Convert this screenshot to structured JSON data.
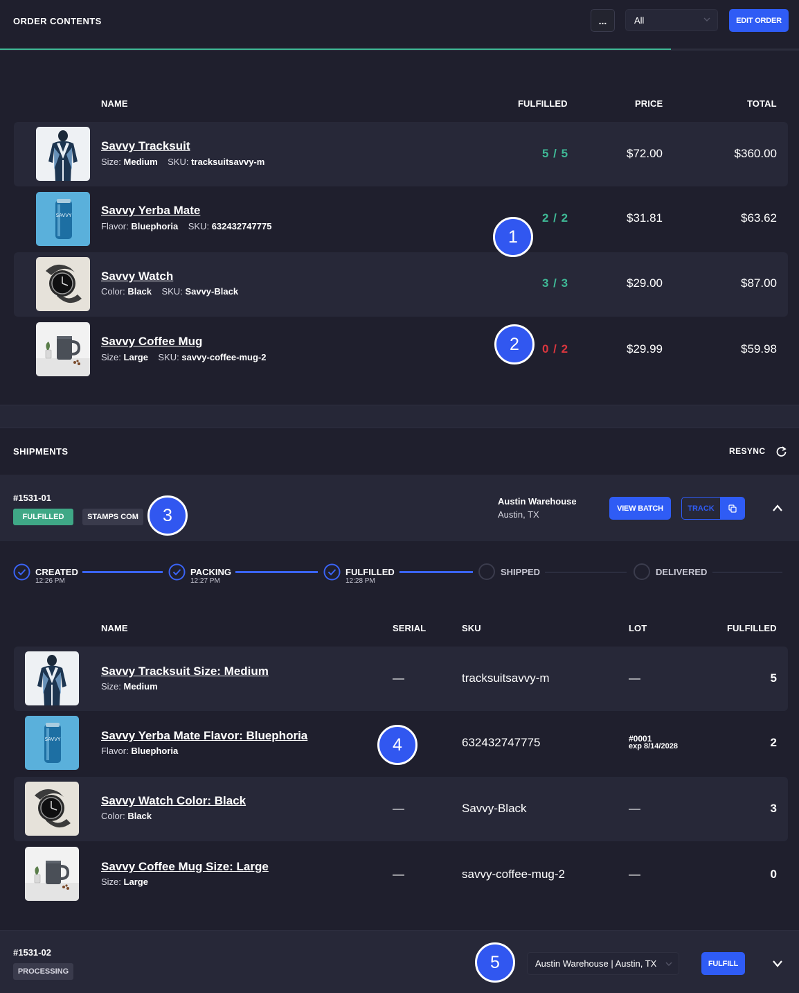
{
  "header": {
    "title": "ORDER CONTENTS",
    "more_label": "...",
    "filter_value": "All",
    "edit_label": "EDIT ORDER"
  },
  "progress": 0.84,
  "order_table": {
    "headers": {
      "name": "NAME",
      "fulfilled": "FULFILLED",
      "price": "PRICE",
      "total": "TOTAL"
    },
    "rows": [
      {
        "name": "Savvy Tracksuit",
        "attr_label": "Size:",
        "attr_value": "Medium",
        "sku_label": "SKU:",
        "sku": "tracksuitsavvy-m",
        "fulfilled": "5 / 5",
        "status": "complete",
        "price": "$72.00",
        "total": "$360.00"
      },
      {
        "name": "Savvy Yerba Mate",
        "attr_label": "Flavor:",
        "attr_value": "Bluephoria",
        "sku_label": "SKU:",
        "sku": "632432747775",
        "fulfilled": "2 / 2",
        "status": "complete",
        "price": "$31.81",
        "total": "$63.62"
      },
      {
        "name": "Savvy Watch",
        "attr_label": "Color:",
        "attr_value": "Black",
        "sku_label": "SKU:",
        "sku": "Savvy-Black",
        "fulfilled": "3 / 3",
        "status": "complete",
        "price": "$29.00",
        "total": "$87.00"
      },
      {
        "name": "Savvy Coffee Mug",
        "attr_label": "Size:",
        "attr_value": "Large",
        "sku_label": "SKU:",
        "sku": "savvy-coffee-mug-2",
        "fulfilled": "0 / 2",
        "status": "pending",
        "price": "$29.99",
        "total": "$59.98"
      }
    ]
  },
  "markers": [
    "1",
    "2",
    "3",
    "4",
    "5"
  ],
  "shipments": {
    "title": "SHIPMENTS",
    "resync_label": "RESYNC",
    "first": {
      "id": "#1531-01",
      "status": "FULFILLED",
      "carrier": "STAMPS COM",
      "warehouse": "Austin Warehouse",
      "location": "Austin, TX",
      "view_batch_label": "VIEW BATCH",
      "track_label": "TRACK",
      "steps": [
        {
          "label": "CREATED",
          "time": "12:26 PM",
          "done": true
        },
        {
          "label": "PACKING",
          "time": "12:27 PM",
          "done": true
        },
        {
          "label": "FULFILLED",
          "time": "12:28 PM",
          "done": true
        },
        {
          "label": "SHIPPED",
          "time": "",
          "done": false
        },
        {
          "label": "DELIVERED",
          "time": "",
          "done": false
        }
      ],
      "table": {
        "headers": {
          "name": "NAME",
          "serial": "SERIAL",
          "sku": "SKU",
          "lot": "LOT",
          "fulfilled": "FULFILLED"
        },
        "rows": [
          {
            "name": "Savvy Tracksuit Size: Medium",
            "attr_label": "Size:",
            "attr_value": "Medium",
            "serial": "—",
            "sku": "tracksuitsavvy-m",
            "lot": "—",
            "lot_exp": "",
            "qty": "5"
          },
          {
            "name": "Savvy Yerba Mate Flavor: Bluephoria",
            "attr_label": "Flavor:",
            "attr_value": "Bluephoria",
            "serial": "",
            "sku": "632432747775",
            "lot": "#0001",
            "lot_exp": "exp 8/14/2028",
            "qty": "2"
          },
          {
            "name": "Savvy Watch Color: Black",
            "attr_label": "Color:",
            "attr_value": "Black",
            "serial": "—",
            "sku": "Savvy-Black",
            "lot": "—",
            "lot_exp": "",
            "qty": "3"
          },
          {
            "name": "Savvy Coffee Mug Size: Large",
            "attr_label": "Size:",
            "attr_value": "Large",
            "serial": "—",
            "sku": "savvy-coffee-mug-2",
            "lot": "—",
            "lot_exp": "",
            "qty": "0"
          }
        ]
      }
    },
    "second": {
      "id": "#1531-02",
      "status": "PROCESSING",
      "warehouse_select": "Austin Warehouse | Austin, TX",
      "fulfill_label": "FULFILL"
    }
  },
  "colors": {
    "accent": "#2f5cf5",
    "success": "#3fb996",
    "danger": "#d9363e",
    "background": "#1f1f2d",
    "row": "#272838"
  },
  "icons": [
    "ellipsis-icon",
    "chevron-down-icon",
    "refresh-icon",
    "copy-icon",
    "chevron-up-icon",
    "check-circle-icon"
  ]
}
